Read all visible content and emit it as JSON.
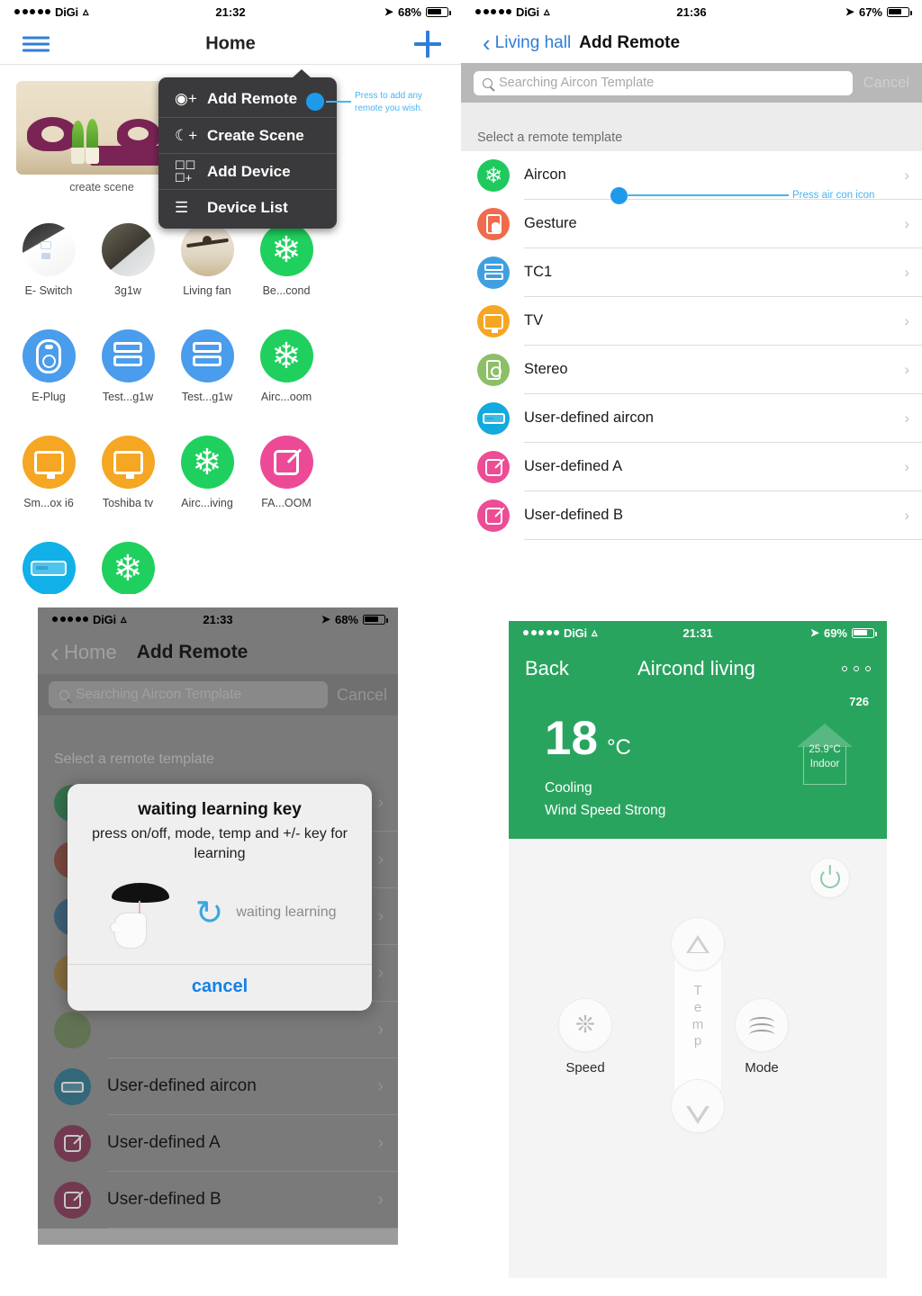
{
  "panel1": {
    "status": {
      "carrier": "DiGi",
      "time": "21:32",
      "battery": "68%"
    },
    "nav": {
      "title": "Home",
      "menu_icon": "hamburger-icon",
      "add_icon": "plus-icon"
    },
    "scene": {
      "label": "create scene"
    },
    "menu": {
      "items": [
        {
          "label": "Add Remote",
          "icon": "add-remote-icon"
        },
        {
          "label": "Create Scene",
          "icon": "moon-plus-icon"
        },
        {
          "label": "Add Device",
          "icon": "add-device-icon"
        },
        {
          "label": "Device List",
          "icon": "list-icon"
        }
      ]
    },
    "annotation": "Press to add any remote you wish.",
    "devices": [
      {
        "label": "E- Switch",
        "type": "photo-a",
        "color": "#e8e8e8"
      },
      {
        "label": "3g1w",
        "type": "photo-b",
        "color": "#555555"
      },
      {
        "label": "Living fan",
        "type": "photo-c",
        "color": "#ded2b6"
      },
      {
        "label": "Be...cond",
        "type": "snowflake",
        "color": "#1fd05e"
      },
      {
        "label": "E-Plug",
        "type": "plug",
        "color": "#4a9ced"
      },
      {
        "label": "Test...g1w",
        "type": "twobar",
        "color": "#4a9ced"
      },
      {
        "label": "Test...g1w",
        "type": "twobar",
        "color": "#4a9ced"
      },
      {
        "label": "Airc...oom",
        "type": "snowflake",
        "color": "#1fd05e"
      },
      {
        "label": "Sm...ox i6",
        "type": "tv",
        "color": "#f5a623"
      },
      {
        "label": "Toshiba tv",
        "type": "tv",
        "color": "#f5a623"
      },
      {
        "label": "Airc...iving",
        "type": "snowflake",
        "color": "#1fd05e"
      },
      {
        "label": "FA...OOM",
        "type": "pen",
        "color": "#ec4a96"
      },
      {
        "label": "",
        "type": "aircon",
        "color": "#12b0e8"
      },
      {
        "label": "",
        "type": "snowflake",
        "color": "#1fd05e"
      }
    ]
  },
  "panel2": {
    "status": {
      "carrier": "DiGi",
      "time": "21:36",
      "battery": "67%"
    },
    "nav": {
      "back_label": "Living hall",
      "title": "Add Remote"
    },
    "search": {
      "placeholder": "Searching Aircon Template",
      "cancel_label": "Cancel"
    },
    "section_caption": "Select a remote template",
    "annotation": "Press air con icon",
    "templates": [
      {
        "label": "Aircon",
        "icon": "snowflake-icon",
        "color": "#1fc95e",
        "selected": true
      },
      {
        "label": "Gesture",
        "icon": "hand-gesture-icon",
        "color": "#ef6b4b",
        "selected": false
      },
      {
        "label": "TC1",
        "icon": "two-bar-switch-icon",
        "color": "#3f9fe0",
        "selected": false
      },
      {
        "label": "TV",
        "icon": "tv-icon",
        "color": "#f5a623",
        "selected": false
      },
      {
        "label": "Stereo",
        "icon": "stereo-icon",
        "color": "#8cbf66",
        "selected": false
      },
      {
        "label": "User-defined aircon",
        "icon": "aircon-unit-icon",
        "color": "#13aadd",
        "selected": false
      },
      {
        "label": "User-defined A",
        "icon": "pen-square-icon",
        "color": "#ec4d94",
        "selected": false
      },
      {
        "label": "User-defined B",
        "icon": "pen-square-icon",
        "color": "#ec4d94",
        "selected": false
      }
    ]
  },
  "panel3": {
    "status": {
      "carrier": "DiGi",
      "time": "21:33",
      "battery": "68%"
    },
    "nav": {
      "back_label": "Home",
      "title": "Add Remote"
    },
    "search": {
      "placeholder": "Searching Aircon Template",
      "cancel_label": "Cancel"
    },
    "section_caption": "Select a remote template",
    "dialog": {
      "title": "waiting learning key",
      "body": "press on/off, mode, temp and +/- key for learning",
      "status_text": "waiting learning",
      "cancel_label": "cancel",
      "refresh_icon": "refresh-icon",
      "remote_icon": "remote-hand-icon"
    },
    "templates": [
      {
        "label": "User-defined aircon",
        "icon": "aircon-unit-icon",
        "color": "#1390b8"
      },
      {
        "label": "User-defined A",
        "icon": "pen-square-icon",
        "color": "#c03a72"
      },
      {
        "label": "User-defined B",
        "icon": "pen-square-icon",
        "color": "#c03a72"
      }
    ]
  },
  "panel4": {
    "status": {
      "carrier": "DiGi",
      "time": "21:31",
      "battery": "69%"
    },
    "nav": {
      "back_label": "Back",
      "title": "Aircond living",
      "more_icon": "three-dots-icon"
    },
    "code": "726",
    "temperature": {
      "value": "18",
      "unit": "°C"
    },
    "mode_line1": "Cooling",
    "mode_line2": "Wind Speed Strong",
    "indoor": {
      "temp": "25.9°C",
      "label": "Indoor"
    },
    "controls": {
      "power_icon": "power-icon",
      "temp_label": "T\ne\nm\np",
      "up_icon": "triangle-up-icon",
      "down_icon": "triangle-down-icon",
      "speed_label": "Speed",
      "speed_icon": "fan-icon",
      "mode_label": "Mode",
      "mode_icon": "waves-icon"
    },
    "colors": {
      "header_green": "#29a45f",
      "body": "#f4f4f4"
    }
  }
}
